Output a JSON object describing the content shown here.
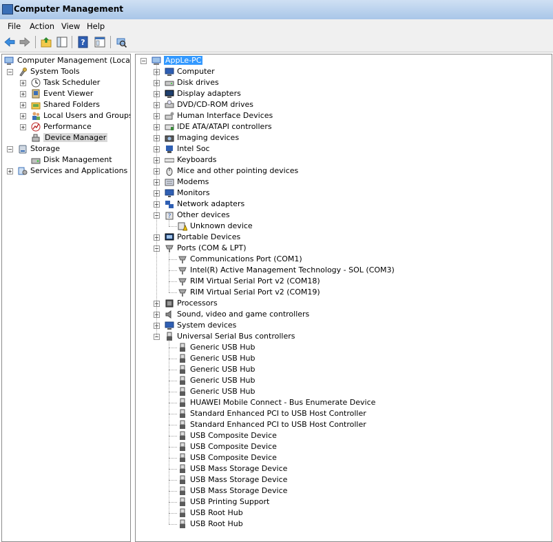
{
  "window": {
    "title": "Computer Management"
  },
  "menu": [
    "File",
    "Action",
    "View",
    "Help"
  ],
  "toolbar": [
    "back-icon",
    "forward-icon",
    "up-folder-icon",
    "show-hide-tree-icon",
    "help-icon",
    "console-tree-icon",
    "scan-hardware-icon"
  ],
  "left_tree": [
    {
      "label": "Computer Management (Local)",
      "level": 0,
      "expander": "none",
      "icon": "computer-management-icon"
    },
    {
      "label": "System Tools",
      "level": 1,
      "expander": "minus",
      "icon": "system-tools-icon"
    },
    {
      "label": "Task Scheduler",
      "level": 2,
      "expander": "plus",
      "icon": "task-scheduler-icon"
    },
    {
      "label": "Event Viewer",
      "level": 2,
      "expander": "plus",
      "icon": "event-viewer-icon"
    },
    {
      "label": "Shared Folders",
      "level": 2,
      "expander": "plus",
      "icon": "shared-folders-icon"
    },
    {
      "label": "Local Users and Groups",
      "level": 2,
      "expander": "plus",
      "icon": "users-icon"
    },
    {
      "label": "Performance",
      "level": 2,
      "expander": "plus",
      "icon": "performance-icon"
    },
    {
      "label": "Device Manager",
      "level": 2,
      "expander": "none",
      "icon": "device-manager-icon",
      "selected": true
    },
    {
      "label": "Storage",
      "level": 1,
      "expander": "minus",
      "icon": "storage-icon"
    },
    {
      "label": "Disk Management",
      "level": 2,
      "expander": "none",
      "icon": "disk-management-icon"
    },
    {
      "label": "Services and Applications",
      "level": 1,
      "expander": "plus",
      "icon": "services-icon"
    }
  ],
  "device_tree": {
    "root": "AppLe-PC",
    "categories": [
      {
        "label": "Computer",
        "expanded": false,
        "icon": "computer-icon"
      },
      {
        "label": "Disk drives",
        "expanded": false,
        "icon": "disk-drive-icon"
      },
      {
        "label": "Display adapters",
        "expanded": false,
        "icon": "display-adapter-icon"
      },
      {
        "label": "DVD/CD-ROM drives",
        "expanded": false,
        "icon": "dvd-drive-icon"
      },
      {
        "label": "Human Interface Devices",
        "expanded": false,
        "icon": "hid-icon"
      },
      {
        "label": "IDE ATA/ATAPI controllers",
        "expanded": false,
        "icon": "ide-controller-icon"
      },
      {
        "label": "Imaging devices",
        "expanded": false,
        "icon": "imaging-device-icon"
      },
      {
        "label": "Intel Soc",
        "expanded": false,
        "icon": "intel-soc-icon"
      },
      {
        "label": "Keyboards",
        "expanded": false,
        "icon": "keyboard-icon"
      },
      {
        "label": "Mice and other pointing devices",
        "expanded": false,
        "icon": "mouse-icon"
      },
      {
        "label": "Modems",
        "expanded": false,
        "icon": "modem-icon"
      },
      {
        "label": "Monitors",
        "expanded": false,
        "icon": "monitor-icon"
      },
      {
        "label": "Network adapters",
        "expanded": false,
        "icon": "network-adapter-icon"
      },
      {
        "label": "Other devices",
        "expanded": true,
        "icon": "other-devices-icon",
        "children": [
          {
            "label": "Unknown device",
            "icon": "warning-device-icon"
          }
        ]
      },
      {
        "label": "Portable Devices",
        "expanded": false,
        "icon": "portable-device-icon"
      },
      {
        "label": "Ports (COM & LPT)",
        "expanded": true,
        "icon": "port-icon",
        "children": [
          {
            "label": "Communications Port (COM1)",
            "icon": "port-icon"
          },
          {
            "label": "Intel(R) Active Management Technology - SOL (COM3)",
            "icon": "port-icon"
          },
          {
            "label": "RIM Virtual Serial Port v2 (COM18)",
            "icon": "port-icon"
          },
          {
            "label": "RIM Virtual Serial Port v2 (COM19)",
            "icon": "port-icon"
          }
        ]
      },
      {
        "label": "Processors",
        "expanded": false,
        "icon": "processor-icon"
      },
      {
        "label": "Sound, video and game controllers",
        "expanded": false,
        "icon": "sound-icon"
      },
      {
        "label": "System devices",
        "expanded": false,
        "icon": "system-device-icon"
      },
      {
        "label": "Universal Serial Bus controllers",
        "expanded": true,
        "icon": "usb-icon",
        "children": [
          {
            "label": "Generic USB Hub",
            "icon": "usb-icon"
          },
          {
            "label": "Generic USB Hub",
            "icon": "usb-icon"
          },
          {
            "label": "Generic USB Hub",
            "icon": "usb-icon"
          },
          {
            "label": "Generic USB Hub",
            "icon": "usb-icon"
          },
          {
            "label": "Generic USB Hub",
            "icon": "usb-icon"
          },
          {
            "label": "HUAWEI Mobile Connect - Bus Enumerate Device",
            "icon": "usb-icon"
          },
          {
            "label": "Standard Enhanced PCI to USB Host Controller",
            "icon": "usb-icon"
          },
          {
            "label": "Standard Enhanced PCI to USB Host Controller",
            "icon": "usb-icon"
          },
          {
            "label": "USB Composite Device",
            "icon": "usb-icon"
          },
          {
            "label": "USB Composite Device",
            "icon": "usb-icon"
          },
          {
            "label": "USB Composite Device",
            "icon": "usb-icon"
          },
          {
            "label": "USB Mass Storage Device",
            "icon": "usb-icon"
          },
          {
            "label": "USB Mass Storage Device",
            "icon": "usb-icon"
          },
          {
            "label": "USB Mass Storage Device",
            "icon": "usb-icon"
          },
          {
            "label": "USB Printing Support",
            "icon": "usb-icon"
          },
          {
            "label": "USB Root Hub",
            "icon": "usb-icon"
          },
          {
            "label": "USB Root Hub",
            "icon": "usb-icon"
          }
        ]
      }
    ]
  },
  "colors": {
    "selection": "#3399ff",
    "selection_inactive": "#d9d9d9",
    "titlebar": "#b9d1ea",
    "chrome": "#f0f0f0"
  }
}
